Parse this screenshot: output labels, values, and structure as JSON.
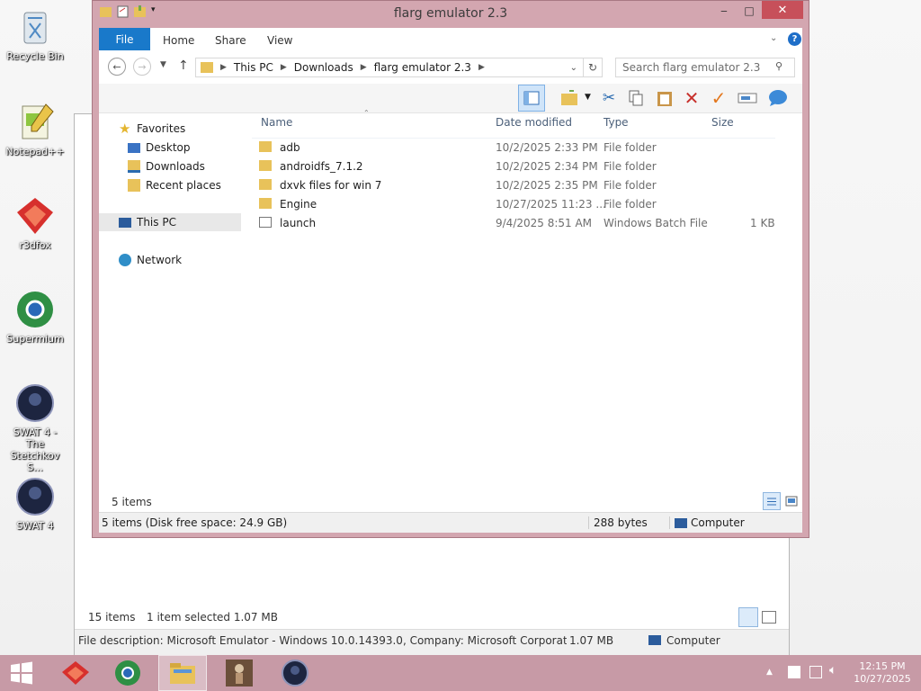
{
  "desktop": {
    "icons": [
      {
        "label": "Recycle Bin"
      },
      {
        "label": "Notepad++"
      },
      {
        "label": "r3dfox"
      },
      {
        "label": "Supermium"
      },
      {
        "label": "SWAT 4 - The Stetchkov S..."
      },
      {
        "label": "SWAT 4"
      }
    ]
  },
  "window": {
    "title": "flarg emulator 2.3",
    "ribbon_tabs": [
      "File",
      "Home",
      "Share",
      "View"
    ],
    "breadcrumb": [
      "This PC",
      "Downloads",
      "flarg emulator 2.3"
    ],
    "search_placeholder": "Search flarg emulator 2.3",
    "nav": {
      "favorites": "Favorites",
      "desktop": "Desktop",
      "downloads": "Downloads",
      "recent": "Recent places",
      "this_pc": "This PC",
      "network": "Network"
    },
    "columns": [
      "Name",
      "Date modified",
      "Type",
      "Size"
    ],
    "files": [
      {
        "name": "adb",
        "date": "10/2/2025 2:33 PM",
        "type": "File folder",
        "size": ""
      },
      {
        "name": "androidfs_7.1.2",
        "date": "10/2/2025 2:34 PM",
        "type": "File folder",
        "size": ""
      },
      {
        "name": "dxvk files for win 7",
        "date": "10/2/2025 2:35 PM",
        "type": "File folder",
        "size": ""
      },
      {
        "name": "Engine",
        "date": "10/27/2025 11:23 ...",
        "type": "File folder",
        "size": ""
      },
      {
        "name": "launch",
        "date": "9/4/2025 8:51 AM",
        "type": "Windows Batch File",
        "size": "1 KB"
      }
    ],
    "item_count": "5 items",
    "status": {
      "left": "5 items (Disk free space: 24.9 GB)",
      "size": "288 bytes",
      "location": "Computer"
    }
  },
  "background_window": {
    "items": "15 items",
    "selected": "1 item selected  1.07 MB",
    "description": "File description: Microsoft Emulator - Windows 10.0.14393.0, Company: Microsoft Corporation, File vers",
    "size": "1.07 MB",
    "location": "Computer"
  },
  "taskbar": {
    "time": "12:15 PM",
    "date": "10/27/2025"
  },
  "colors": {
    "window_frame": "#d3a6b0",
    "taskbar": "#c79aa6",
    "file_tab": "#1979ca",
    "close_button": "#c7505a"
  }
}
